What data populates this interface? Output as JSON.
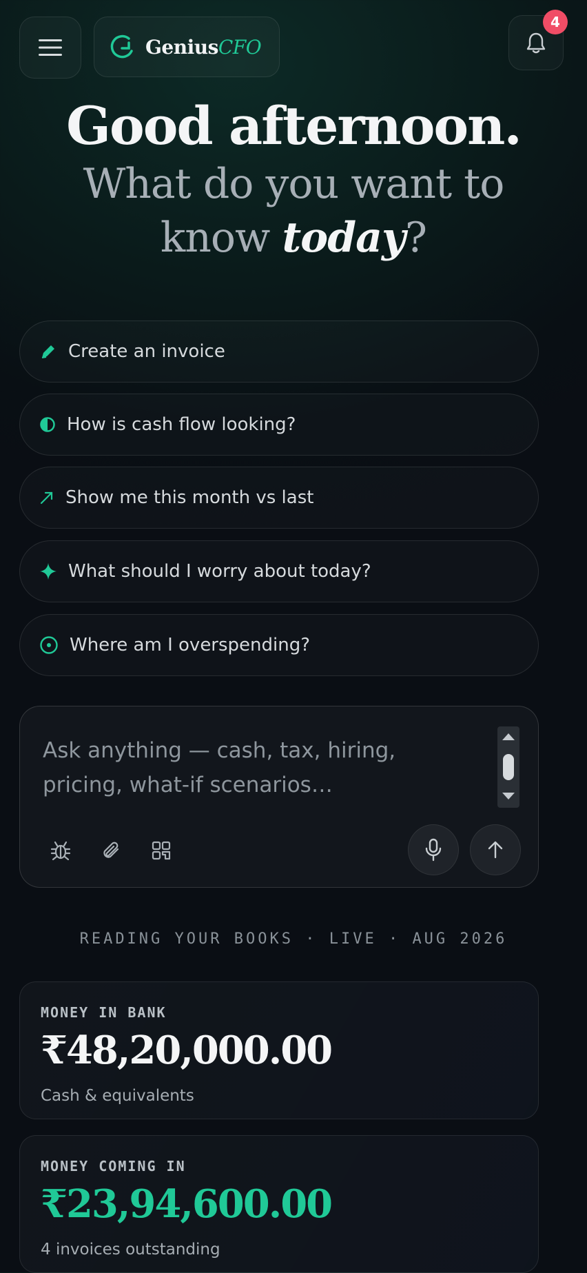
{
  "header": {
    "brand_primary": "Genius",
    "brand_accent": "CFO",
    "notification_count": "4"
  },
  "hero": {
    "greeting": "Good afternoon.",
    "question_line1": "What do you want to",
    "question_word": "know",
    "question_emphasis": "today",
    "question_mark": "?"
  },
  "suggestions": [
    {
      "label": "Create an invoice",
      "icon": "pencil-icon"
    },
    {
      "label": "How is cash flow looking?",
      "icon": "half-circle-icon"
    },
    {
      "label": "Show me this month vs last",
      "icon": "trend-arrow-icon"
    },
    {
      "label": "What should I worry about today?",
      "icon": "sparkle-icon"
    },
    {
      "label": "Where am I overspending?",
      "icon": "target-icon"
    }
  ],
  "composer": {
    "placeholder": "Ask anything — cash, tax, hiring, pricing, what-if scenarios…",
    "tools": [
      "bug-icon",
      "paperclip-icon",
      "grid-icon"
    ],
    "mic_icon": "microphone-icon",
    "send_icon": "arrow-up-icon"
  },
  "status": {
    "text": "READING YOUR BOOKS · LIVE · AUG 2026"
  },
  "cards": [
    {
      "label": "MONEY IN BANK",
      "amount": "₹48,20,000.00",
      "sub": "Cash & equivalents",
      "color": "#f4f5f6"
    },
    {
      "label": "MONEY COMING IN",
      "amount": "₹23,94,600.00",
      "sub": "4 invoices outstanding",
      "color": "#20c997"
    }
  ],
  "colors": {
    "accent": "#20c997",
    "badge": "#f04d66"
  }
}
